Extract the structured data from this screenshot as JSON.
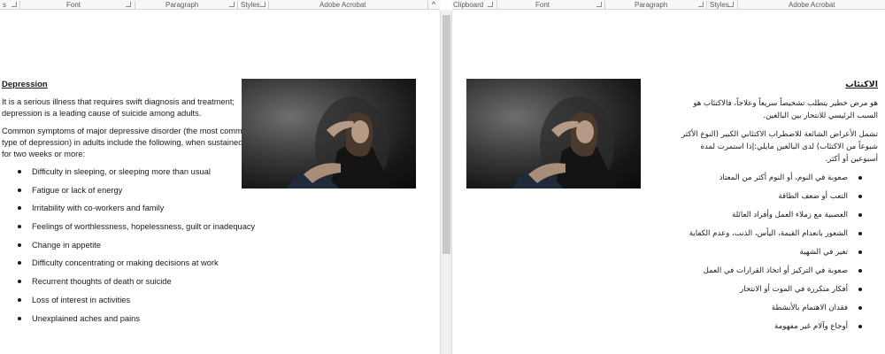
{
  "ribbon": {
    "left": {
      "groups": [
        "Font",
        "Paragraph",
        "Styles",
        "Adobe Acrobat"
      ]
    },
    "right": {
      "groups": [
        "Clipboard",
        "Font",
        "Paragraph",
        "Styles",
        "Adobe Acrobat"
      ]
    },
    "collapse_glyph": "^"
  },
  "doc_en": {
    "heading": "Depression",
    "para1": "It is a serious illness that requires swift diagnosis and treatment; depression is a leading cause of suicide among adults.",
    "para2": "Common symptoms of major depressive disorder (the most common type of depression) in adults include the following, when sustained for two weeks or more:",
    "bullets": [
      "Difficulty in sleeping, or sleeping more than usual",
      "Fatigue or lack of energy",
      "Irritability with co-workers and family",
      "Feelings of worthlessness, hopelessness, guilt or inadequacy",
      "Change in appetite",
      "Difficulty concentrating or making decisions at work",
      "Recurrent thoughts of death or suicide",
      "Loss of interest in activities",
      "Unexplained aches and pains"
    ]
  },
  "doc_ar": {
    "heading": "الاكتئاب",
    "para1": "هو مرض خطير يتطلب تشخيصاً سريعاً وعلاجاً، فالاكتئاب هو السبب الرئيسي للانتحار بين البالغين.",
    "para2": "تشمل الأعراض الشائعة للاضطراب الاكتئابي الكبير (النوع الأكثر شيوعاً من الاكتئاب) لدى البالغين مايلي:إذا استمرت لمدة أسبوعين أو أكثر.",
    "bullets": [
      "صعوبة في النوم، أو النوم أكثر من المعتاد",
      "التعب أو ضعف الطاقة",
      "العصبية مع زملاء العمل وأفراد العائلة",
      "الشعور بانعدام القيمة، اليأس، الذنب، وعدم الكفاية",
      "تغير في الشهية",
      "صعوبة في التركيز أو اتخاذ القرارات في العمل",
      "أفكار متكررة في الموت أو الانتحار",
      "فقدان الاهتمام بالأنشطة",
      "أوجاع وآلام غير مفهومة"
    ]
  }
}
